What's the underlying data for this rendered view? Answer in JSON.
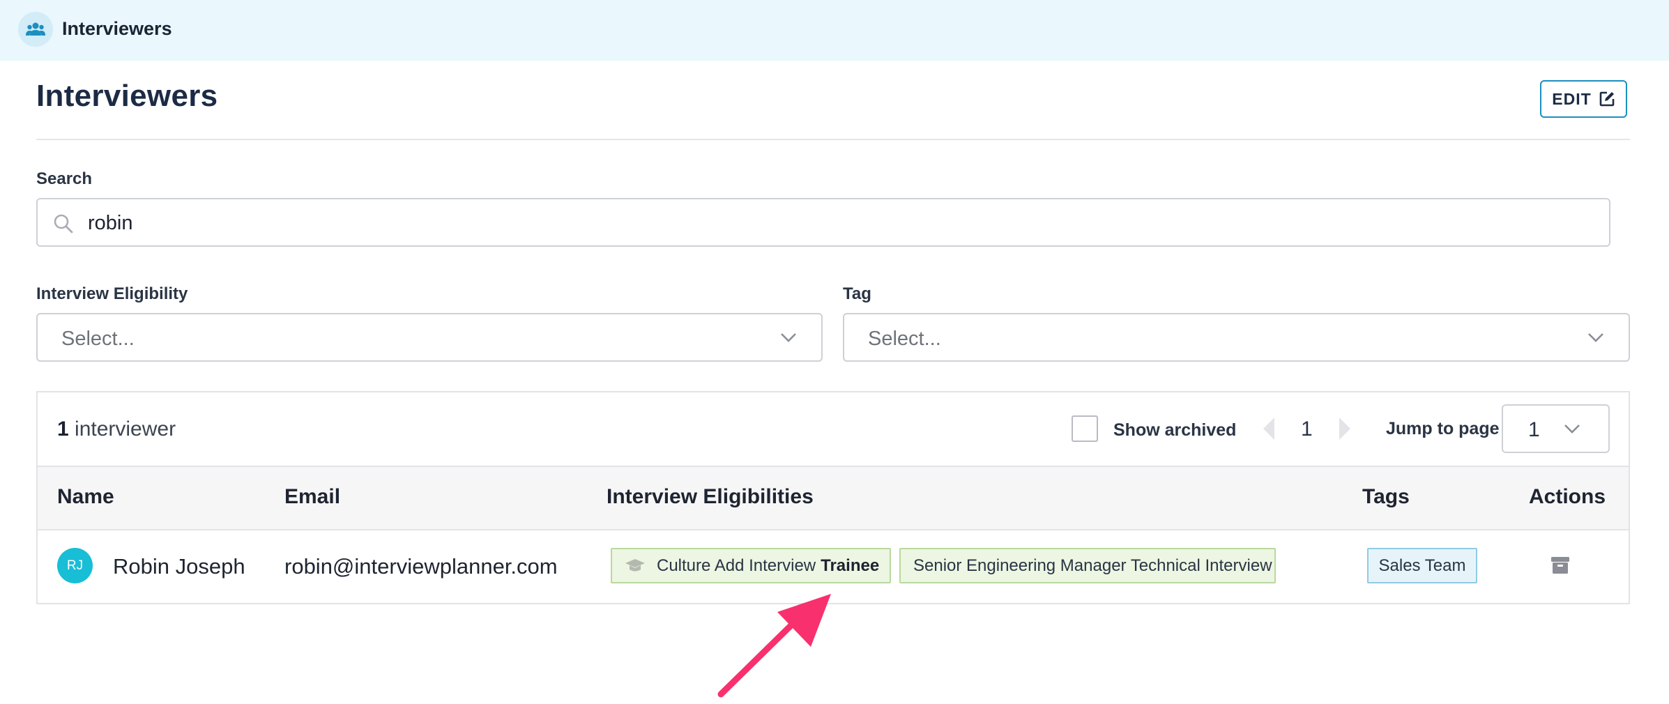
{
  "topbar": {
    "title": "Interviewers",
    "icon": "users-icon"
  },
  "page": {
    "title": "Interviewers",
    "edit_label": "EDIT"
  },
  "search": {
    "label": "Search",
    "value": "robin"
  },
  "filters": {
    "eligibility": {
      "label": "Interview Eligibility",
      "placeholder": "Select..."
    },
    "tag": {
      "label": "Tag",
      "placeholder": "Select..."
    }
  },
  "results": {
    "count": "1",
    "count_suffix": "interviewer",
    "show_archived_label": "Show archived",
    "page": "1",
    "jump_label": "Jump to page",
    "jump_value": "1"
  },
  "table": {
    "headers": {
      "name": "Name",
      "email": "Email",
      "eligibilities": "Interview Eligibilities",
      "tags": "Tags",
      "actions": "Actions"
    },
    "rows": [
      {
        "initials": "RJ",
        "name": "Robin Joseph",
        "email": "robin@interviewplanner.com",
        "eligibilities": [
          {
            "name": "Culture Add Interview",
            "status": "Trainee",
            "icon": "graduation-cap-icon"
          },
          {
            "name": "Senior Engineering Manager Technical Interview"
          }
        ],
        "tags": [
          "Sales Team"
        ]
      }
    ]
  },
  "colors": {
    "accent": "#1c8fbf",
    "avatar": "#17bed6",
    "eligibility_bg": "#ecf6e2",
    "tag_bg": "#e6f4fa",
    "annotation_arrow": "#f8306e"
  }
}
